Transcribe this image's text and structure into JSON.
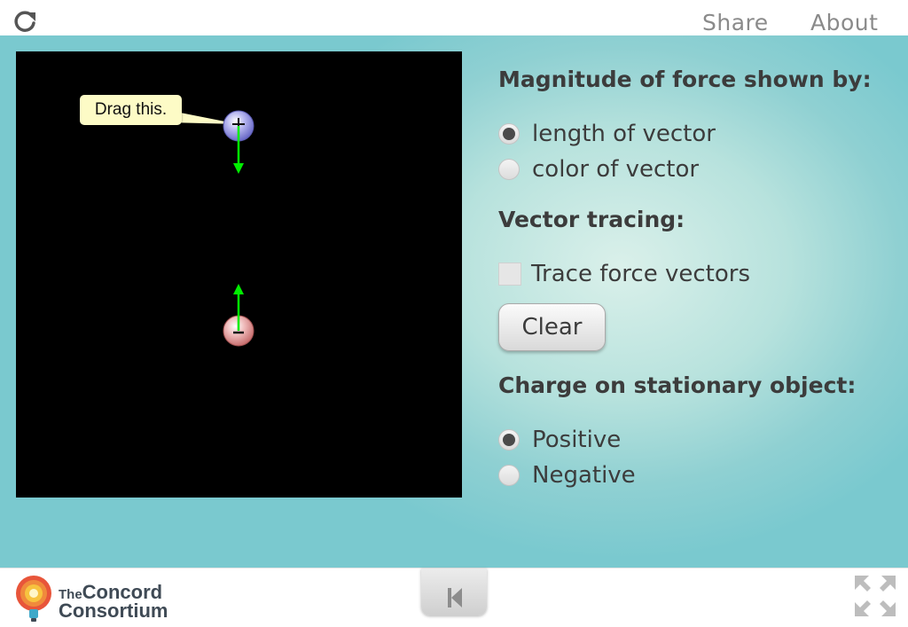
{
  "topbar": {
    "reload_icon": "reload-icon",
    "share_label": "Share",
    "about_label": "About"
  },
  "simulation": {
    "callout_text": "Drag this.",
    "moving_charge": {
      "sign": "+",
      "color": "#8e8ee0"
    },
    "stationary_charge": {
      "sign": "-",
      "color": "#e09a9a"
    },
    "vector_color": "#00ff00"
  },
  "panel": {
    "magnitude": {
      "heading": "Magnitude of force shown by:",
      "options": [
        {
          "label": "length of vector",
          "selected": true
        },
        {
          "label": "color of vector",
          "selected": false
        }
      ]
    },
    "tracing": {
      "heading": "Vector tracing:",
      "checkbox_label": "Trace force vectors",
      "checked": false,
      "clear_label": "Clear"
    },
    "charge": {
      "heading": "Charge on stationary object:",
      "options": [
        {
          "label": "Positive",
          "selected": true
        },
        {
          "label": "Negative",
          "selected": false
        }
      ]
    }
  },
  "bottombar": {
    "logo_line1_small": "The",
    "logo_line1": "Concord",
    "logo_line2": "Consortium",
    "reset_icon": "skip-to-start-icon",
    "fullscreen_icon": "fullscreen-icon"
  }
}
